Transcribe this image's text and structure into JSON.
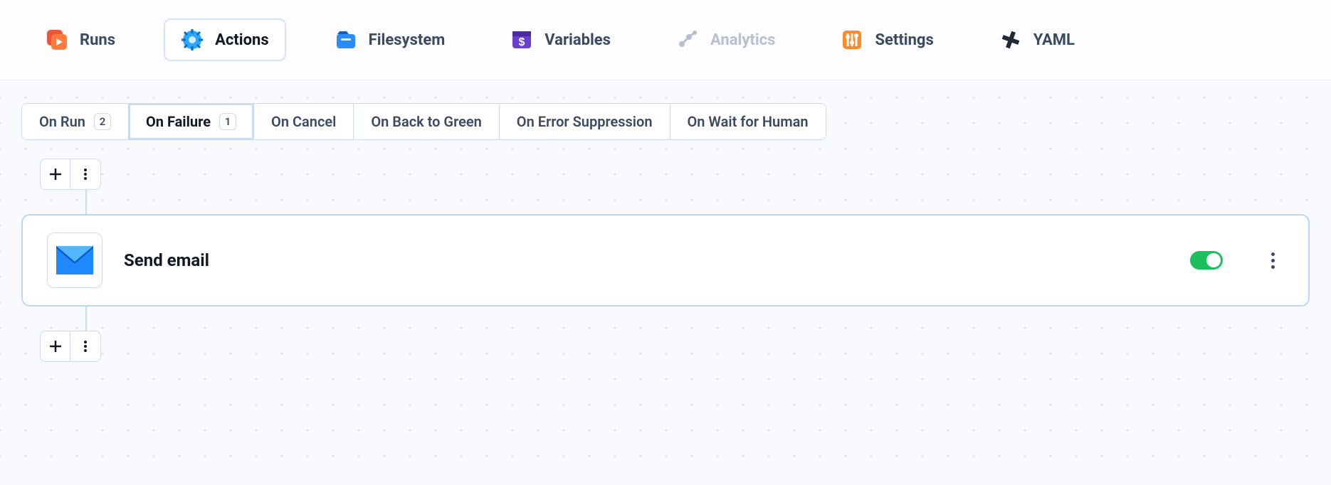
{
  "nav": {
    "tabs": [
      {
        "key": "runs",
        "label": "Runs"
      },
      {
        "key": "actions",
        "label": "Actions"
      },
      {
        "key": "filesystem",
        "label": "Filesystem"
      },
      {
        "key": "variables",
        "label": "Variables"
      },
      {
        "key": "analytics",
        "label": "Analytics"
      },
      {
        "key": "settings",
        "label": "Settings"
      },
      {
        "key": "yaml",
        "label": "YAML"
      }
    ],
    "active": "actions",
    "disabled": [
      "analytics"
    ]
  },
  "triggers": {
    "items": [
      {
        "key": "on-run",
        "label": "On Run",
        "count": 2
      },
      {
        "key": "on-failure",
        "label": "On Failure",
        "count": 1
      },
      {
        "key": "on-cancel",
        "label": "On Cancel"
      },
      {
        "key": "on-back",
        "label": "On Back to Green"
      },
      {
        "key": "on-error",
        "label": "On Error Suppression"
      },
      {
        "key": "on-wait",
        "label": "On Wait for Human"
      }
    ],
    "active": "on-failure"
  },
  "action": {
    "title": "Send email",
    "enabled": true
  }
}
